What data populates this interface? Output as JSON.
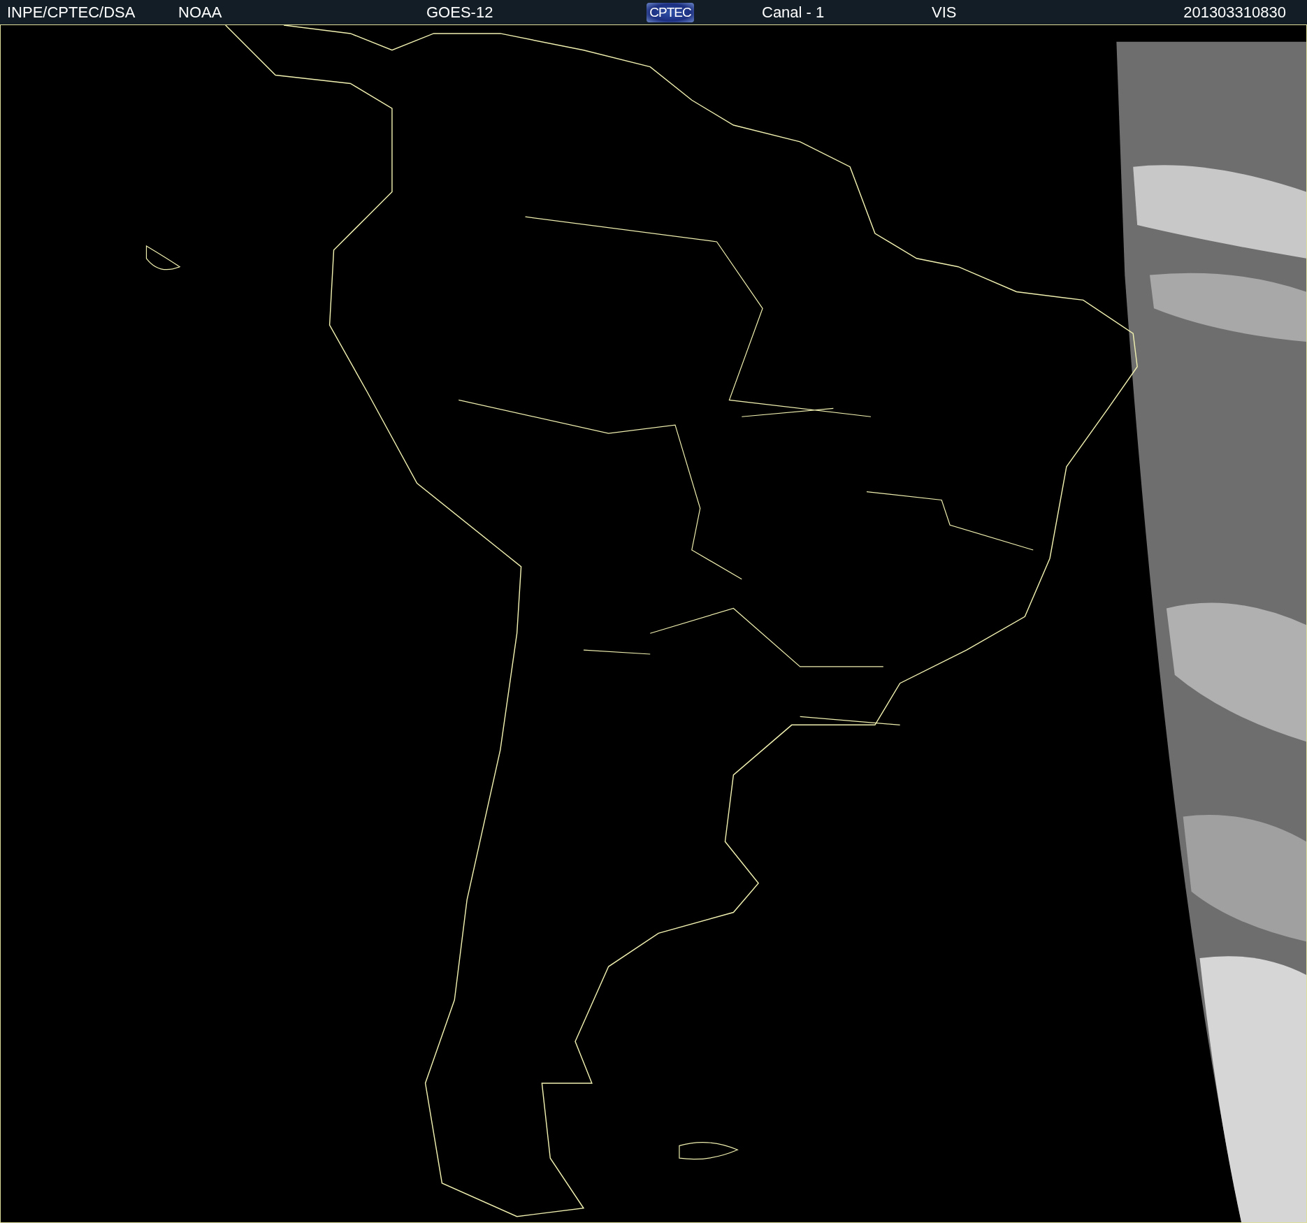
{
  "header": {
    "items": [
      {
        "kind": "text",
        "text": "INPE/CPTEC/DSA"
      },
      {
        "kind": "text",
        "text": "NOAA"
      },
      {
        "kind": "text",
        "text": "GOES-12"
      },
      {
        "kind": "logo",
        "text": "CPTEC"
      },
      {
        "kind": "text",
        "text": "Canal - 1"
      },
      {
        "kind": "text",
        "text": "VIS"
      },
      {
        "kind": "text",
        "text": "201303310830"
      }
    ]
  }
}
